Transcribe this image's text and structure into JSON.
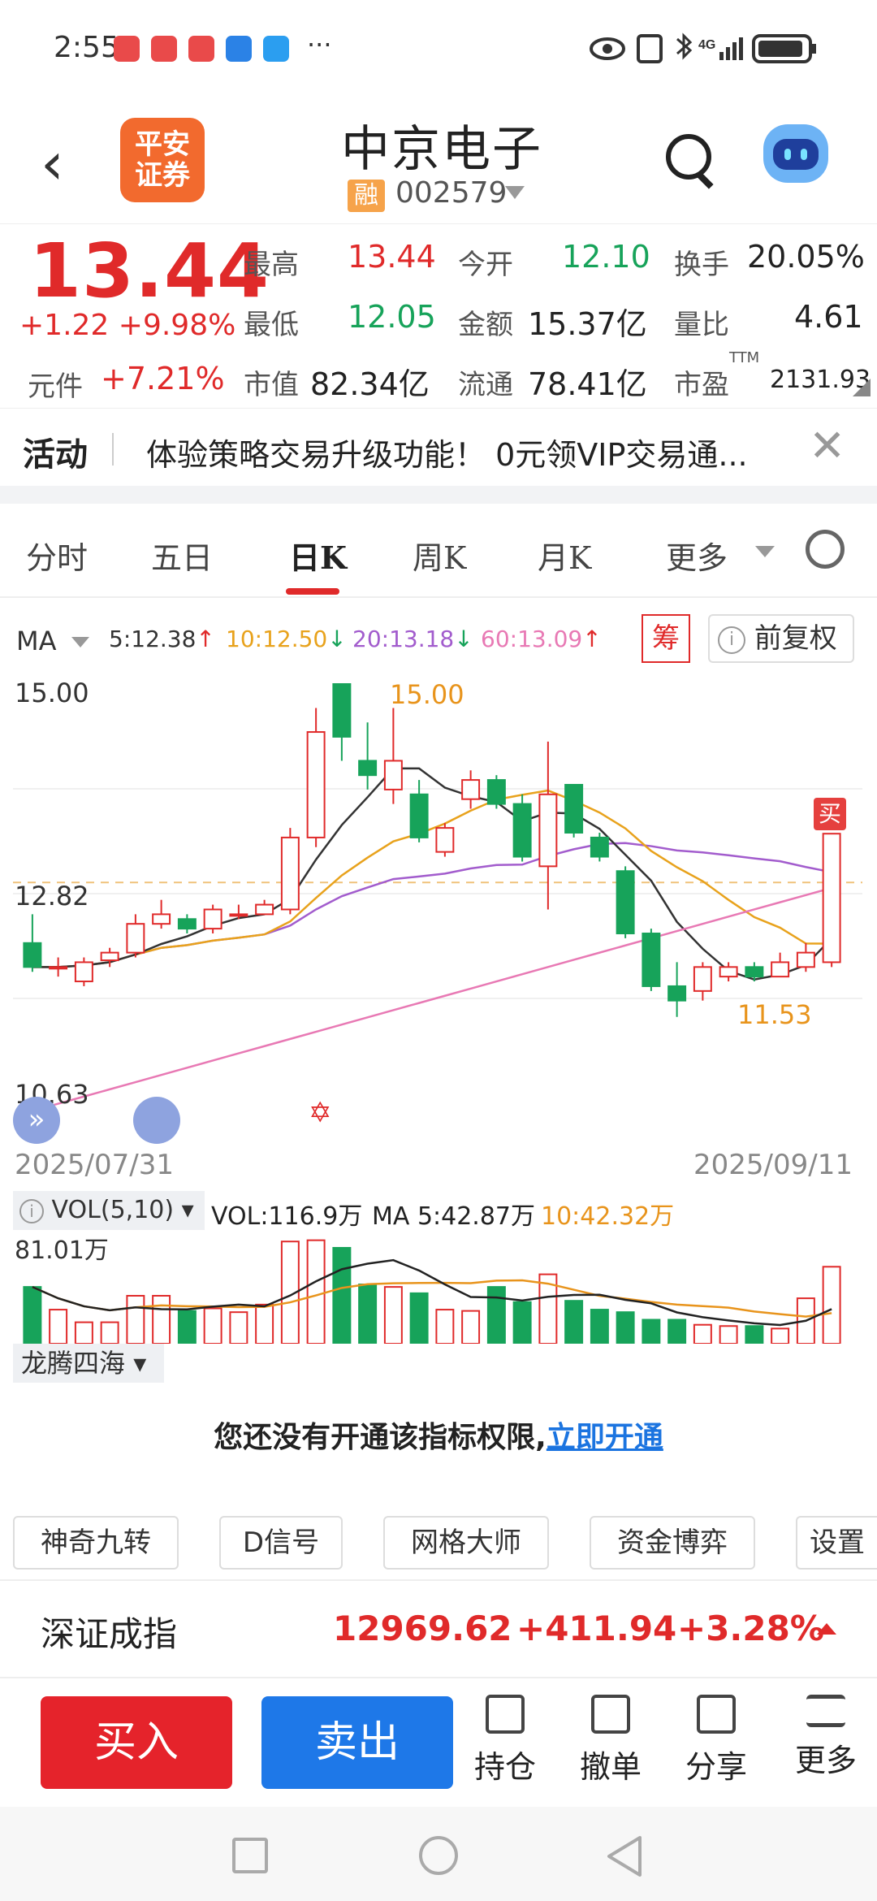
{
  "status_bar": {
    "time": "2:55",
    "more": "···",
    "network": "4G"
  },
  "header": {
    "back_icon": "chevron-left-icon",
    "broker_logo_line1": "平安",
    "broker_logo_line2": "证券",
    "stock_name": "中京电子",
    "margin_badge": "融",
    "stock_code": "002579"
  },
  "quote": {
    "price": "13.44",
    "change": "+1.22",
    "change_pct": "+9.98%",
    "sub_label": "元件",
    "sub_pct": "+7.21%",
    "high_label": "最高",
    "high": "13.44",
    "open_label": "今开",
    "open": "12.10",
    "turnover_label": "换手",
    "turnover": "20.05%",
    "low_label": "最低",
    "low": "12.05",
    "amount_label": "金额",
    "amount": "15.37亿",
    "vol_ratio_label": "量比",
    "vol_ratio": "4.61",
    "mcap_label": "市值",
    "mcap": "82.34亿",
    "float_label": "流通",
    "float_cap": "78.41亿",
    "pe_label": "市盈",
    "pe_sup": "TTM",
    "pe": "2131.93"
  },
  "activity": {
    "title": "活动",
    "text": "体验策略交易升级功能！ 0元领VIP交易通...",
    "close": "✕"
  },
  "tabs": [
    "分时",
    "五日",
    "日K",
    "周K",
    "月K",
    "更多"
  ],
  "ma_row": {
    "label": "MA",
    "ma5": "5:12.38",
    "ma10": "10:12.50",
    "ma20": "20:13.18",
    "ma60": "60:13.09",
    "ma5_arrow": "↑",
    "ma10_arrow": "↓",
    "ma20_arrow": "↓",
    "ma60_arrow": "↑",
    "chip_button": "筹",
    "adjust_button": "前复权",
    "colors": {
      "ma5": "#333333",
      "ma10": "#e8a21c",
      "ma20": "#a25ccd",
      "ma60": "#e879b4"
    }
  },
  "chart": {
    "y_top": "15.00",
    "y_mid": "12.82",
    "y_bottom": "10.63",
    "high_marker": "15.00",
    "low_marker": "11.53",
    "buy_marker": "买",
    "date_start": "2025/07/31",
    "date_end": "2025/09/11"
  },
  "volume": {
    "indicator": "VOL(5,10)",
    "vol": "VOL:116.9万",
    "ma5": "MA 5:42.87万",
    "ma10": "10:42.32万",
    "y_label": "81.01万"
  },
  "indicator_selector": "龙腾四海",
  "permission": {
    "text": "您还没有开通该指标权限,",
    "link": "立即开通"
  },
  "tools": [
    "神奇九转",
    "D信号",
    "网格大师",
    "资金博弈",
    "设置"
  ],
  "index_bar": {
    "name": "深证成指",
    "value": "12969.62",
    "change": "+411.94",
    "pct": "+3.28%"
  },
  "trade_bar": {
    "buy": "买入",
    "sell": "卖出",
    "actions": [
      "持仓",
      "撤单",
      "分享",
      "更多"
    ]
  },
  "chart_data": {
    "type": "candlestick",
    "x_range": [
      "2025/07/31",
      "2025/09/11"
    ],
    "ylim": [
      10.63,
      15.0
    ],
    "candles": [
      {
        "o": 12.3,
        "c": 12.05,
        "h": 12.6,
        "l": 12.0
      },
      {
        "o": 12.05,
        "c": 12.05,
        "h": 12.15,
        "l": 11.95
      },
      {
        "o": 11.9,
        "c": 12.1,
        "h": 12.15,
        "l": 11.85
      },
      {
        "o": 12.12,
        "c": 12.2,
        "h": 12.25,
        "l": 12.05
      },
      {
        "o": 12.2,
        "c": 12.5,
        "h": 12.6,
        "l": 12.15
      },
      {
        "o": 12.5,
        "c": 12.6,
        "h": 12.75,
        "l": 12.45
      },
      {
        "o": 12.55,
        "c": 12.45,
        "h": 12.6,
        "l": 12.4
      },
      {
        "o": 12.45,
        "c": 12.65,
        "h": 12.7,
        "l": 12.4
      },
      {
        "o": 12.6,
        "c": 12.6,
        "h": 12.7,
        "l": 12.55
      },
      {
        "o": 12.6,
        "c": 12.7,
        "h": 12.75,
        "l": 12.6
      },
      {
        "o": 12.65,
        "c": 13.4,
        "h": 13.5,
        "l": 12.6
      },
      {
        "o": 13.4,
        "c": 14.5,
        "h": 14.75,
        "l": 13.3
      },
      {
        "o": 15.0,
        "c": 14.45,
        "h": 15.0,
        "l": 14.2
      },
      {
        "o": 14.2,
        "c": 14.05,
        "h": 14.6,
        "l": 13.9
      },
      {
        "o": 13.9,
        "c": 14.2,
        "h": 14.75,
        "l": 13.75
      },
      {
        "o": 13.85,
        "c": 13.4,
        "h": 14.0,
        "l": 13.35
      },
      {
        "o": 13.25,
        "c": 13.5,
        "h": 13.55,
        "l": 13.2
      },
      {
        "o": 13.8,
        "c": 14.0,
        "h": 14.1,
        "l": 13.7
      },
      {
        "o": 14.0,
        "c": 13.75,
        "h": 14.05,
        "l": 13.7
      },
      {
        "o": 13.75,
        "c": 13.2,
        "h": 13.85,
        "l": 13.15
      },
      {
        "o": 13.1,
        "c": 13.85,
        "h": 14.4,
        "l": 12.65
      },
      {
        "o": 13.95,
        "c": 13.45,
        "h": 13.95,
        "l": 13.4
      },
      {
        "o": 13.4,
        "c": 13.2,
        "h": 13.45,
        "l": 13.15
      },
      {
        "o": 13.05,
        "c": 12.4,
        "h": 13.1,
        "l": 12.35
      },
      {
        "o": 12.4,
        "c": 11.85,
        "h": 12.45,
        "l": 11.8
      },
      {
        "o": 11.85,
        "c": 11.7,
        "h": 12.1,
        "l": 11.53
      },
      {
        "o": 11.8,
        "c": 12.05,
        "h": 12.1,
        "l": 11.7
      },
      {
        "o": 11.95,
        "c": 12.05,
        "h": 12.1,
        "l": 11.9
      },
      {
        "o": 12.05,
        "c": 11.95,
        "h": 12.1,
        "l": 11.9
      },
      {
        "o": 11.95,
        "c": 12.1,
        "h": 12.2,
        "l": 11.95
      },
      {
        "o": 12.05,
        "c": 12.2,
        "h": 12.3,
        "l": 12.0
      },
      {
        "o": 12.1,
        "c": 13.44,
        "h": 13.44,
        "l": 12.05
      }
    ],
    "volumes": [
      45,
      27,
      17,
      17,
      38,
      38,
      26,
      28,
      25,
      31,
      81,
      82,
      76,
      47,
      45,
      40,
      27,
      26,
      45,
      33,
      55,
      34,
      27,
      25,
      19,
      19,
      15,
      14,
      14,
      12,
      36,
      61
    ]
  }
}
